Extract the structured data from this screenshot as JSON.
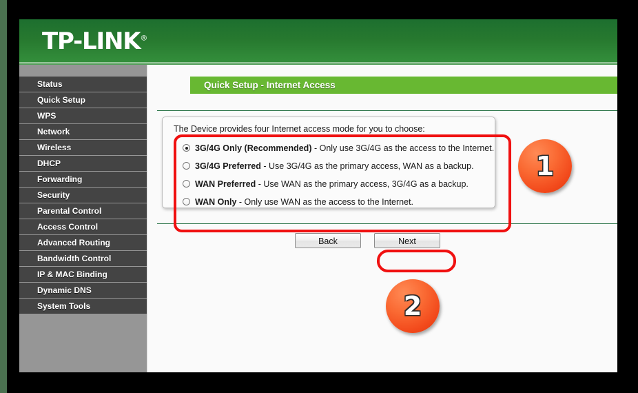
{
  "brand": {
    "logo_text": "TP-LINK",
    "registered_mark": "®",
    "header_green_dark": "#1d6f2f",
    "header_green_light": "#35913d"
  },
  "sidebar": {
    "items": [
      {
        "label": "Status"
      },
      {
        "label": "Quick Setup"
      },
      {
        "label": "WPS"
      },
      {
        "label": "Network"
      },
      {
        "label": "Wireless"
      },
      {
        "label": "DHCP"
      },
      {
        "label": "Forwarding"
      },
      {
        "label": "Security"
      },
      {
        "label": "Parental Control"
      },
      {
        "label": "Access Control"
      },
      {
        "label": "Advanced Routing"
      },
      {
        "label": "Bandwidth Control"
      },
      {
        "label": "IP & MAC Binding"
      },
      {
        "label": "Dynamic DNS"
      },
      {
        "label": "System Tools"
      }
    ]
  },
  "content": {
    "page_title": "Quick Setup - Internet Access",
    "title_bar_color": "#68b832",
    "intro_text": "The Device provides four Internet access mode for you to choose:",
    "options": [
      {
        "name": "3G/4G Only (Recommended)",
        "description": " - Only use 3G/4G as the access to the Internet.",
        "selected": true
      },
      {
        "name": "3G/4G Preferred",
        "description": " - Use 3G/4G as the primary access, WAN as a backup.",
        "selected": false
      },
      {
        "name": "WAN Preferred",
        "description": " - Use WAN as the primary access, 3G/4G as a backup.",
        "selected": false
      },
      {
        "name": "WAN Only",
        "description": " - Only use WAN as the access to the Internet.",
        "selected": false
      }
    ],
    "buttons": {
      "back_label": "Back",
      "next_label": "Next"
    }
  },
  "annotations": {
    "highlight_color": "#f01010",
    "badges": [
      {
        "number": "1"
      },
      {
        "number": "2"
      }
    ]
  }
}
